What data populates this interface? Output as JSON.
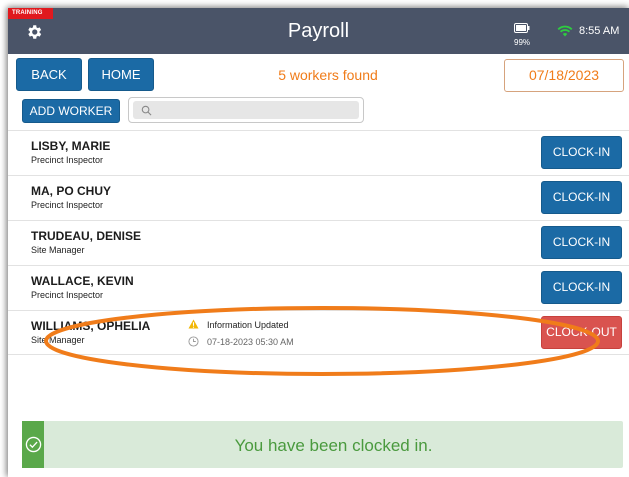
{
  "header": {
    "training_badge": "TRAINING",
    "title": "Payroll",
    "battery": "99%",
    "time": "8:55 AM"
  },
  "toolbar": {
    "back_label": "BACK",
    "home_label": "HOME",
    "found_text": "5 workers found",
    "date": "07/18/2023",
    "add_worker_label": "ADD WORKER",
    "search_value": ""
  },
  "workers": [
    {
      "name": "LISBY, MARIE",
      "role": "Precinct Inspector",
      "action": "CLOCK-IN"
    },
    {
      "name": "MA, PO CHUY",
      "role": "Precinct Inspector",
      "action": "CLOCK-IN"
    },
    {
      "name": "TRUDEAU, DENISE",
      "role": "Site Manager",
      "action": "CLOCK-IN"
    },
    {
      "name": "WALLACE, KEVIN",
      "role": "Precinct Inspector",
      "action": "CLOCK-IN"
    },
    {
      "name": "WILLIAMS, OPHELIA",
      "role": "Site Manager",
      "action": "CLOCK-OUT",
      "info_message": "Information Updated",
      "info_time": "07-18-2023 05:30 AM"
    }
  ],
  "toast": {
    "message": "You have been clocked in."
  },
  "colors": {
    "header_bg": "#4a5468",
    "primary": "#1b6aa5",
    "danger": "#d9534f",
    "accent_orange": "#f07c1a",
    "success_bg": "#d9ead9",
    "success_bar": "#5aa84a",
    "training_red": "#e0191e"
  },
  "icons": [
    "gear-icon",
    "battery-icon",
    "wifi-icon",
    "search-icon",
    "warning-icon",
    "clock-icon",
    "check-circle-icon"
  ]
}
